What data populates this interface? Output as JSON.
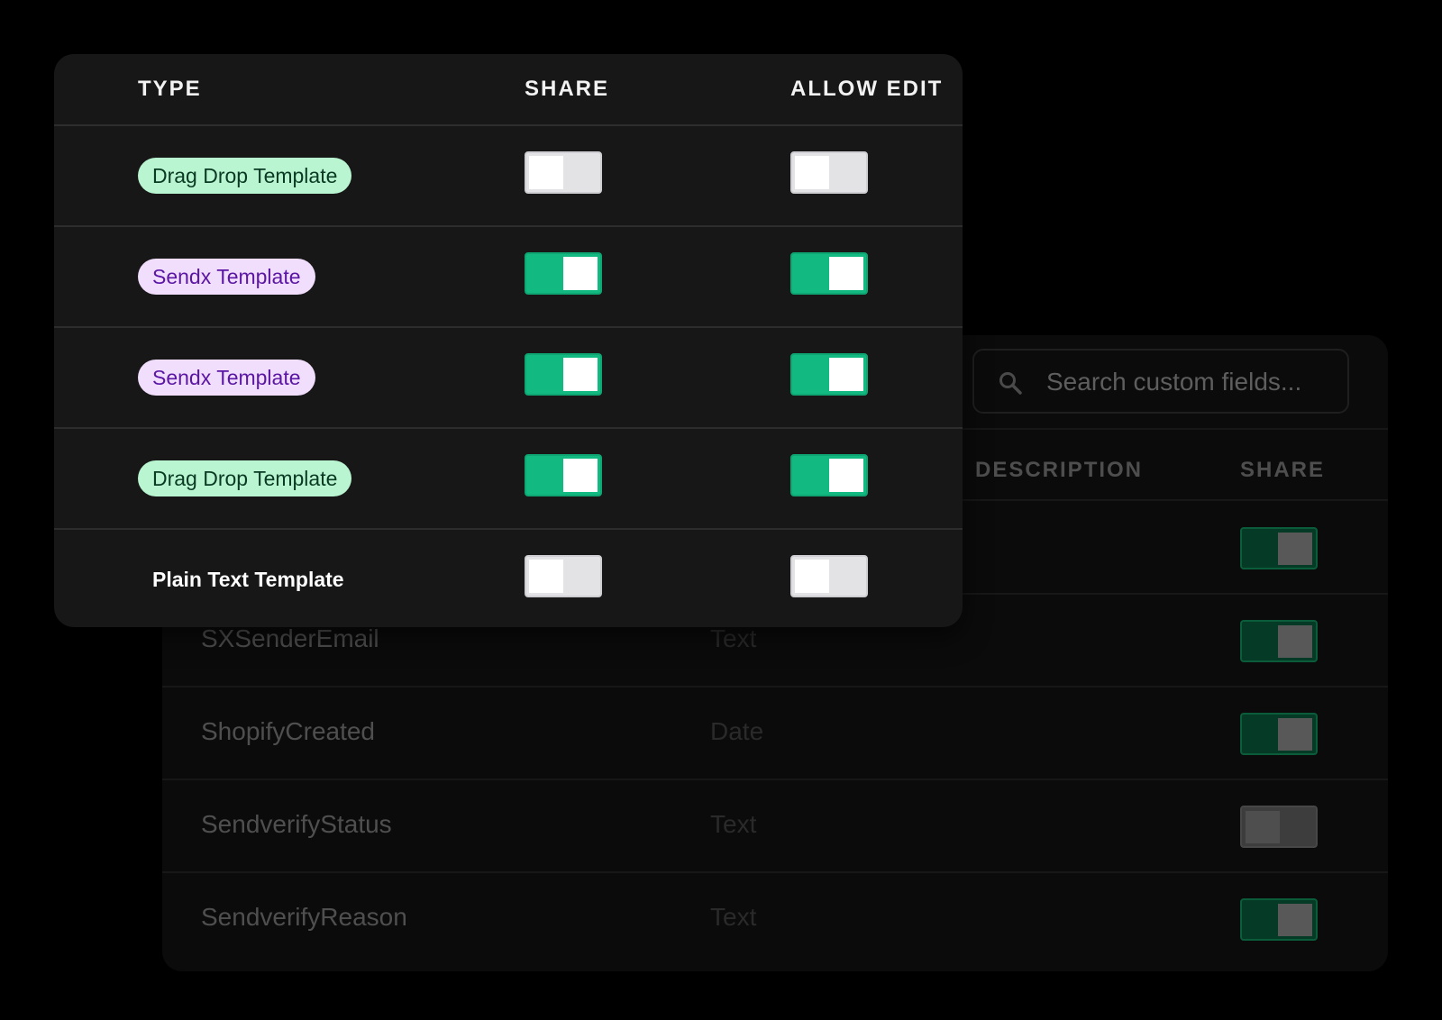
{
  "colors": {
    "toggle_on": "#12b981",
    "toggle_off": "#e3e3e6",
    "pill_green_bg": "#b9f5d0",
    "pill_purple_bg": "#f0defc",
    "panel_bg": "#171717"
  },
  "template_panel": {
    "headers": {
      "type": "TYPE",
      "share": "SHARE",
      "allow_edit": "ALLOW EDIT"
    },
    "rows": [
      {
        "type": "Drag Drop Template",
        "style": "green",
        "share": false,
        "allow_edit": false
      },
      {
        "type": "Sendx Template",
        "style": "purple",
        "share": true,
        "allow_edit": true
      },
      {
        "type": "Sendx Template",
        "style": "purple",
        "share": true,
        "allow_edit": true
      },
      {
        "type": "Drag Drop Template",
        "style": "green",
        "share": true,
        "allow_edit": true
      },
      {
        "type": "Plain Text Template",
        "style": "plain",
        "share": false,
        "allow_edit": false
      }
    ]
  },
  "custom_fields_panel": {
    "search": {
      "placeholder": "Search custom fields...",
      "icon": "search-icon"
    },
    "headers": {
      "description": "DESCRIPTION",
      "share": "SHARE"
    },
    "rows": [
      {
        "name": "",
        "type": "",
        "share": true
      },
      {
        "name": "SXSenderEmail",
        "type": "Text",
        "share": true
      },
      {
        "name": "ShopifyCreated",
        "type": "Date",
        "share": true
      },
      {
        "name": "SendverifyStatus",
        "type": "Text",
        "share": false
      },
      {
        "name": "SendverifyReason",
        "type": "Text",
        "share": true
      }
    ]
  }
}
